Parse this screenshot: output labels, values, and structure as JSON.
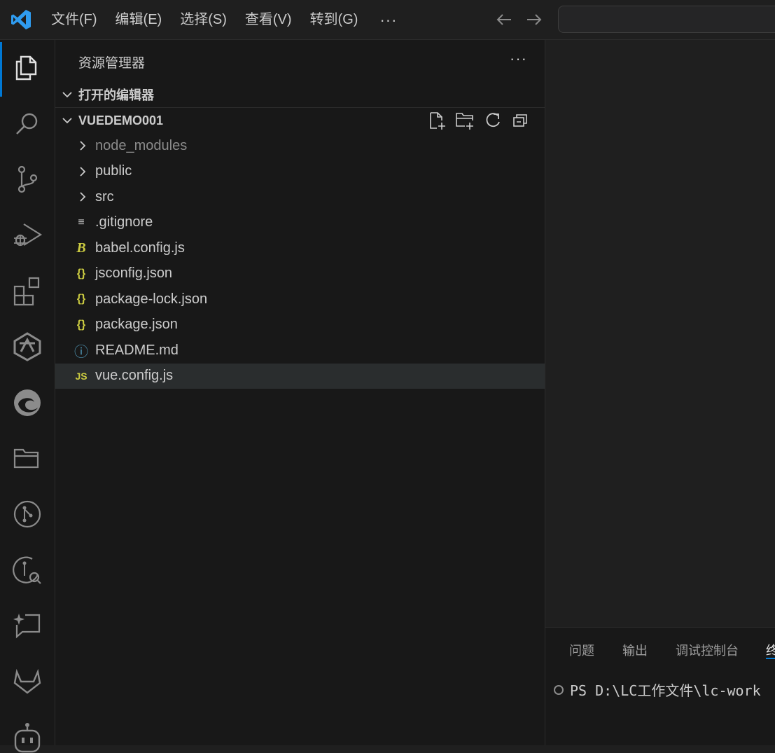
{
  "menu": {
    "items": [
      "文件(F)",
      "编辑(E)",
      "选择(S)",
      "查看(V)",
      "转到(G)"
    ],
    "more": "···"
  },
  "activity_bar": {
    "icons": [
      "explorer-icon",
      "search-icon",
      "source-control-icon",
      "run-debug-icon",
      "extensions-icon",
      "ai-assistant-icon",
      "edge-icon",
      "folder-icon",
      "git-graph-icon",
      "git-search-icon",
      "chat-sparkle-icon",
      "gitlab-icon",
      "copilot-icon"
    ],
    "active": "explorer-icon"
  },
  "sidebar": {
    "title": "资源管理器",
    "more": "···",
    "open_editors_label": "打开的编辑器",
    "project_label": "VUEDEMO001",
    "tree": [
      {
        "name": "node_modules",
        "type": "folder",
        "dimmed": true
      },
      {
        "name": "public",
        "type": "folder"
      },
      {
        "name": "src",
        "type": "folder"
      },
      {
        "name": ".gitignore",
        "type": "file",
        "icon": "≡",
        "icon_color": "#cccccc"
      },
      {
        "name": "babel.config.js",
        "type": "file",
        "icon": "B",
        "icon_color": "#cbcb41"
      },
      {
        "name": "jsconfig.json",
        "type": "file",
        "icon": "{}",
        "icon_color": "#cbcb41"
      },
      {
        "name": "package-lock.json",
        "type": "file",
        "icon": "{}",
        "icon_color": "#cbcb41"
      },
      {
        "name": "package.json",
        "type": "file",
        "icon": "{}",
        "icon_color": "#cbcb41"
      },
      {
        "name": "README.md",
        "type": "file",
        "icon": "ⓘ",
        "icon_color": "#519aba"
      },
      {
        "name": "vue.config.js",
        "type": "file",
        "icon": "JS",
        "icon_color": "#cbcb41",
        "selected": true
      }
    ]
  },
  "panel": {
    "tabs": [
      "问题",
      "输出",
      "调试控制台",
      "终"
    ],
    "terminal_line": "PS D:\\LC工作文件\\lc-work"
  },
  "colors": {
    "accent": "#0078d4",
    "json_icon": "#cbcb41",
    "info_icon": "#519aba"
  }
}
